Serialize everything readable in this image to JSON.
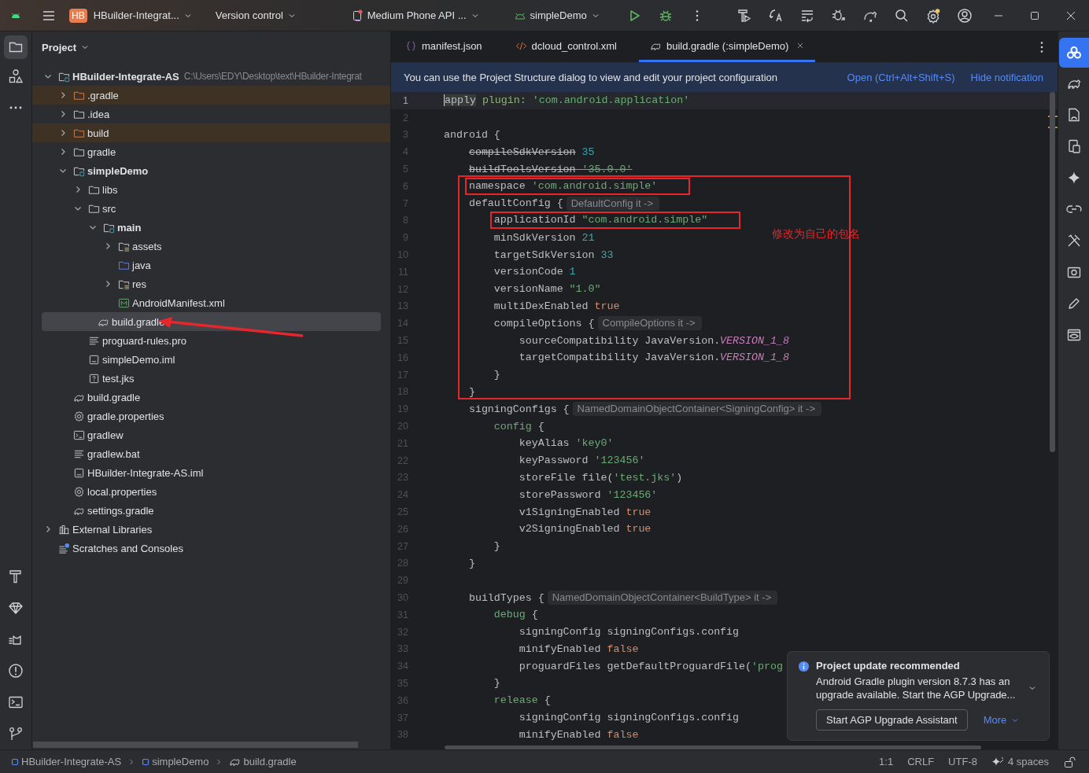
{
  "title_bar": {
    "app_badge": "HB",
    "project": "HBuilder-Integrat...",
    "vcs": "Version control",
    "device": "Medium Phone API ...",
    "run_config": "simpleDemo"
  },
  "project_panel": {
    "title": "Project",
    "tree": [
      {
        "name": "HBuilder-Integrate-AS",
        "kind": "module",
        "path": "C:\\Users\\EDY\\Desktop\\text\\HBuilder-Integrat",
        "expanded": true,
        "selected": false,
        "excluded": false,
        "children": [
          {
            "name": ".gradle",
            "kind": "folder",
            "expanded": false,
            "selected": false,
            "excluded": true
          },
          {
            "name": ".idea",
            "kind": "folder",
            "expanded": false,
            "selected": false,
            "excluded": false
          },
          {
            "name": "build",
            "kind": "folder",
            "expanded": false,
            "selected": false,
            "excluded": true
          },
          {
            "name": "gradle",
            "kind": "folder",
            "expanded": false,
            "selected": false,
            "excluded": false
          },
          {
            "name": "simpleDemo",
            "kind": "module",
            "expanded": true,
            "selected": false,
            "excluded": false,
            "children": [
              {
                "name": "libs",
                "kind": "folder",
                "expanded": false,
                "selected": false,
                "excluded": false
              },
              {
                "name": "src",
                "kind": "folder",
                "expanded": true,
                "selected": false,
                "excluded": false,
                "children": [
                  {
                    "name": "main",
                    "kind": "module",
                    "expanded": true,
                    "selected": false,
                    "excluded": false,
                    "children": [
                      {
                        "name": "assets",
                        "kind": "resfolder",
                        "expanded": false,
                        "selected": false,
                        "excluded": false
                      },
                      {
                        "name": "java",
                        "kind": "srcfolder",
                        "selected": false,
                        "excluded": false
                      },
                      {
                        "name": "res",
                        "kind": "resfolder",
                        "expanded": false,
                        "selected": false,
                        "excluded": false
                      },
                      {
                        "name": "AndroidManifest.xml",
                        "kind": "manifest",
                        "selected": false,
                        "excluded": false
                      }
                    ]
                  }
                ]
              },
              {
                "name": "build.gradle",
                "kind": "gradle",
                "selected": true,
                "excluded": false
              },
              {
                "name": "proguard-rules.pro",
                "kind": "lines",
                "selected": false,
                "excluded": false
              },
              {
                "name": "simpleDemo.iml",
                "kind": "iml",
                "selected": false,
                "excluded": false
              },
              {
                "name": "test.jks",
                "kind": "unknown",
                "selected": false,
                "excluded": false
              }
            ]
          },
          {
            "name": "build.gradle",
            "kind": "gradle",
            "selected": false,
            "excluded": false
          },
          {
            "name": "gradle.properties",
            "kind": "gear",
            "selected": false,
            "excluded": false
          },
          {
            "name": "gradlew",
            "kind": "terminal",
            "selected": false,
            "excluded": false
          },
          {
            "name": "gradlew.bat",
            "kind": "lines",
            "selected": false,
            "excluded": false
          },
          {
            "name": "HBuilder-Integrate-AS.iml",
            "kind": "iml",
            "selected": false,
            "excluded": false
          },
          {
            "name": "local.properties",
            "kind": "gear",
            "selected": false,
            "excluded": false
          },
          {
            "name": "settings.gradle",
            "kind": "gradle",
            "selected": false,
            "excluded": false
          }
        ]
      },
      {
        "name": "External Libraries",
        "kind": "libraries",
        "expanded": false,
        "selected": false,
        "excluded": false
      },
      {
        "name": "Scratches and Consoles",
        "kind": "scratches",
        "selected": false,
        "excluded": false
      }
    ]
  },
  "editor": {
    "tabs": [
      {
        "label": "manifest.json",
        "kind": "json",
        "selected": false
      },
      {
        "label": "dcloud_control.xml",
        "kind": "xml",
        "selected": false
      },
      {
        "label": "build.gradle (:simpleDemo)",
        "kind": "gradle",
        "selected": true
      }
    ],
    "banner": {
      "message": "You can use the Project Structure dialog to view and edit your project configuration",
      "links": [
        "Open (Ctrl+Alt+Shift+S)",
        "Hide notification"
      ]
    },
    "annotation": "修改为自己的包名",
    "lines": [
      {
        "n": "1",
        "current": true,
        "code": [
          {
            "kind": "caret",
            "text": "apply"
          },
          {
            "kind": "named",
            "text": " plugin:"
          },
          {
            "kind": "str",
            "text": " 'com.android.application'"
          }
        ]
      },
      {
        "n": "2",
        "current": false
      },
      {
        "n": "3",
        "current": false,
        "code": [
          {
            "kind": "plain",
            "text": "android {"
          }
        ]
      },
      {
        "n": "4",
        "current": false,
        "code": [
          {
            "kind": "deprecated",
            "text": "    compileSdkVersion"
          },
          {
            "kind": "num",
            "text": " 35"
          }
        ]
      },
      {
        "n": "5",
        "current": false,
        "code": [
          {
            "kind": "deprecated",
            "text": "    buildToolsVersion"
          },
          {
            "kind": "deprecated-str",
            "text": " '35.0.0'"
          }
        ]
      },
      {
        "n": "6",
        "current": false,
        "boxed": true,
        "code": [
          {
            "kind": "plain",
            "text": "    namespace "
          },
          {
            "kind": "str",
            "text": "'com.android.simple'"
          }
        ]
      },
      {
        "n": "7",
        "current": false,
        "code": [
          {
            "kind": "plain",
            "text": "    defaultConfig {"
          }
        ],
        "hint": "DefaultConfig it ->"
      },
      {
        "n": "8",
        "current": false,
        "boxed": true,
        "code": [
          {
            "kind": "plain",
            "text": "        applicationId "
          },
          {
            "kind": "str",
            "text": "\"com.android.simple\""
          }
        ]
      },
      {
        "n": "9",
        "current": false,
        "code": [
          {
            "kind": "plain",
            "text": "        minSdkVersion "
          },
          {
            "kind": "num",
            "text": "21"
          }
        ]
      },
      {
        "n": "10",
        "current": false,
        "code": [
          {
            "kind": "plain",
            "text": "        targetSdkVersion "
          },
          {
            "kind": "num",
            "text": "33"
          }
        ]
      },
      {
        "n": "11",
        "current": false,
        "code": [
          {
            "kind": "plain",
            "text": "        versionCode "
          },
          {
            "kind": "num",
            "text": "1"
          }
        ]
      },
      {
        "n": "12",
        "current": false,
        "code": [
          {
            "kind": "plain",
            "text": "        versionName "
          },
          {
            "kind": "str",
            "text": "\"1.0\""
          }
        ]
      },
      {
        "n": "13",
        "current": false,
        "code": [
          {
            "kind": "plain",
            "text": "        multiDexEnabled "
          },
          {
            "kind": "kw",
            "text": "true"
          }
        ]
      },
      {
        "n": "14",
        "current": false,
        "code": [
          {
            "kind": "plain",
            "text": "        compileOptions {"
          }
        ],
        "hint": "CompileOptions it ->"
      },
      {
        "n": "15",
        "current": false,
        "code": [
          {
            "kind": "plain",
            "text": "            sourceCompatibility JavaVersion."
          },
          {
            "kind": "const",
            "text": "VERSION_1_8"
          }
        ]
      },
      {
        "n": "16",
        "current": false,
        "code": [
          {
            "kind": "plain",
            "text": "            targetCompatibility JavaVersion."
          },
          {
            "kind": "const",
            "text": "VERSION_1_8"
          }
        ]
      },
      {
        "n": "17",
        "current": false,
        "code": [
          {
            "kind": "plain",
            "text": "        }"
          }
        ]
      },
      {
        "n": "18",
        "current": false,
        "code": [
          {
            "kind": "plain",
            "text": "    }"
          }
        ]
      },
      {
        "n": "19",
        "current": false,
        "code": [
          {
            "kind": "plain",
            "text": "    signingConfigs {"
          }
        ],
        "hint": "NamedDomainObjectContainer<SigningConfig> it ->"
      },
      {
        "n": "20",
        "current": false,
        "code": [
          {
            "kind": "block",
            "text": "        config"
          },
          {
            "kind": "plain",
            "text": " {"
          }
        ]
      },
      {
        "n": "21",
        "current": false,
        "code": [
          {
            "kind": "plain",
            "text": "            keyAlias "
          },
          {
            "kind": "str",
            "text": "'key0'"
          }
        ]
      },
      {
        "n": "22",
        "current": false,
        "code": [
          {
            "kind": "plain",
            "text": "            keyPassword "
          },
          {
            "kind": "str",
            "text": "'123456'"
          }
        ]
      },
      {
        "n": "23",
        "current": false,
        "code": [
          {
            "kind": "plain",
            "text": "            storeFile file("
          },
          {
            "kind": "str",
            "text": "'test.jks'"
          },
          {
            "kind": "plain",
            "text": ")"
          }
        ]
      },
      {
        "n": "24",
        "current": false,
        "code": [
          {
            "kind": "plain",
            "text": "            storePassword "
          },
          {
            "kind": "str",
            "text": "'123456'"
          }
        ]
      },
      {
        "n": "25",
        "current": false,
        "code": [
          {
            "kind": "plain",
            "text": "            v1SigningEnabled "
          },
          {
            "kind": "kw",
            "text": "true"
          }
        ]
      },
      {
        "n": "26",
        "current": false,
        "code": [
          {
            "kind": "plain",
            "text": "            v2SigningEnabled "
          },
          {
            "kind": "kw",
            "text": "true"
          }
        ]
      },
      {
        "n": "27",
        "current": false,
        "code": [
          {
            "kind": "plain",
            "text": "        }"
          }
        ]
      },
      {
        "n": "28",
        "current": false,
        "code": [
          {
            "kind": "plain",
            "text": "    }"
          }
        ]
      },
      {
        "n": "29",
        "current": false
      },
      {
        "n": "30",
        "current": false,
        "code": [
          {
            "kind": "plain",
            "text": "    buildTypes {"
          }
        ],
        "hint": "NamedDomainObjectContainer<BuildType> it ->"
      },
      {
        "n": "31",
        "current": false,
        "code": [
          {
            "kind": "block",
            "text": "        debug"
          },
          {
            "kind": "plain",
            "text": " {"
          }
        ]
      },
      {
        "n": "32",
        "current": false,
        "code": [
          {
            "kind": "plain",
            "text": "            signingConfig signingConfigs.config"
          }
        ]
      },
      {
        "n": "33",
        "current": false,
        "code": [
          {
            "kind": "plain",
            "text": "            minifyEnabled "
          },
          {
            "kind": "kw",
            "text": "false"
          }
        ]
      },
      {
        "n": "34",
        "current": false,
        "code": [
          {
            "kind": "plain",
            "text": "            proguardFiles getDefaultProguardFile("
          },
          {
            "kind": "str",
            "text": "'prog"
          }
        ]
      },
      {
        "n": "35",
        "current": false,
        "code": [
          {
            "kind": "plain",
            "text": "        }"
          }
        ]
      },
      {
        "n": "36",
        "current": false,
        "code": [
          {
            "kind": "block",
            "text": "        release"
          },
          {
            "kind": "plain",
            "text": " {"
          }
        ]
      },
      {
        "n": "37",
        "current": false,
        "code": [
          {
            "kind": "plain",
            "text": "            signingConfig signingConfigs.config"
          }
        ]
      },
      {
        "n": "38",
        "current": false,
        "code": [
          {
            "kind": "plain",
            "text": "            minifyEnabled "
          },
          {
            "kind": "kw",
            "text": "false"
          }
        ]
      }
    ],
    "notification": {
      "title": "Project update recommended",
      "body": "Android Gradle plugin version 8.7.3 has an upgrade available. Start the AGP Upgrade...",
      "button": "Start AGP Upgrade Assistant",
      "link": "More"
    }
  },
  "status_bar": {
    "breadcrumbs": [
      {
        "label": "HBuilder-Integrate-AS",
        "kind": "module"
      },
      {
        "label": "simpleDemo",
        "kind": "module"
      },
      {
        "label": "build.gradle",
        "kind": "gradle"
      }
    ],
    "position": "1:1",
    "line_ending": "CRLF",
    "encoding": "UTF-8",
    "indent": "4 spaces"
  }
}
